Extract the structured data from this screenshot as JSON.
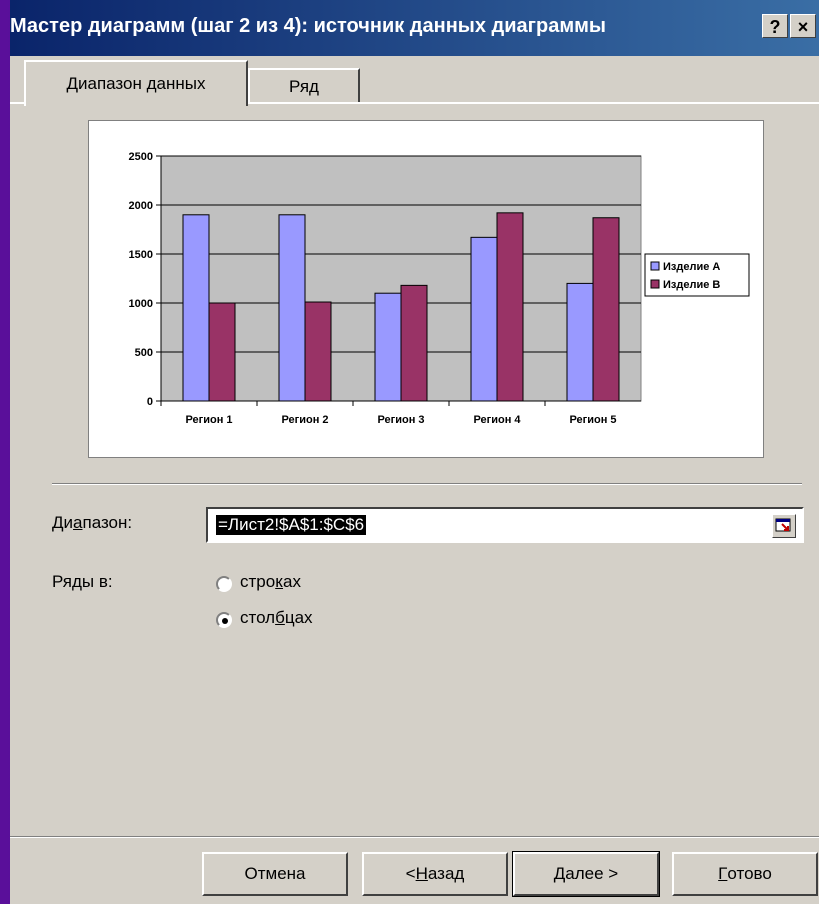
{
  "window": {
    "title": "Мастер диаграмм (шаг 2 из 4): источник данных диаграммы",
    "help_label": "?",
    "close_label": "×"
  },
  "tabs": [
    {
      "label": "Диапазон данных",
      "active": true
    },
    {
      "label": "Ряд",
      "active": false
    }
  ],
  "chart_data": {
    "type": "bar",
    "categories": [
      "Регион 1",
      "Регион 2",
      "Регион 3",
      "Регион 4",
      "Регион 5"
    ],
    "series": [
      {
        "name": "Изделие А",
        "color": "#9999ff",
        "values": [
          1900,
          1900,
          1100,
          1670,
          1200
        ]
      },
      {
        "name": "Изделие В",
        "color": "#993366",
        "values": [
          1000,
          1010,
          1180,
          1920,
          1870
        ]
      }
    ],
    "ylim": [
      0,
      2500
    ],
    "yticks": [
      0,
      500,
      1000,
      1500,
      2000,
      2500
    ],
    "grid": true,
    "legend": "right",
    "plot_background": "#c0c0c0"
  },
  "range": {
    "label_pre": "Ди",
    "label_ul": "а",
    "label_post": "пазон:",
    "value": "=Лист2!$A$1:$C$6",
    "button_icon": "collapse-dialog-icon"
  },
  "series_in": {
    "label": "Ряды в:",
    "options": [
      {
        "pre": "стро",
        "ul": "к",
        "post": "ах",
        "selected": false
      },
      {
        "pre": "стол",
        "ul": "б",
        "post": "цах",
        "selected": true
      }
    ]
  },
  "buttons": {
    "cancel": "Отмена",
    "back_pre": "< ",
    "back_ul": "Н",
    "back_post": "азад",
    "next_ul": "Д",
    "next_post": "алее >",
    "finish_ul": "Г",
    "finish_post": "отово"
  }
}
